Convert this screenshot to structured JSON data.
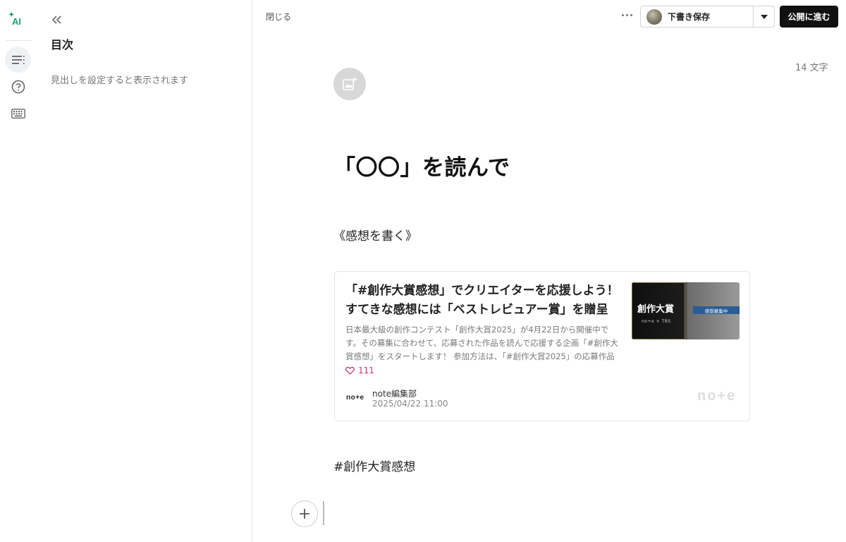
{
  "rail": {
    "ai_label": "AI",
    "items": [
      {
        "icon": "toc-list-icon",
        "active": true
      },
      {
        "icon": "help-icon",
        "active": false
      },
      {
        "icon": "keyboard-icon",
        "active": false
      }
    ]
  },
  "toc": {
    "title": "目次",
    "hint": "見出しを設定すると表示されます"
  },
  "topbar": {
    "close_label": "閉じる",
    "draft_label": "下書き保存",
    "publish_label": "公開に進む"
  },
  "editor": {
    "char_count": "14 文字",
    "title": "「〇〇」を読んで",
    "paragraph": "《感想を書く》",
    "hashtag": "#創作大賞感想"
  },
  "embed": {
    "title": "「#創作大賞感想」でクリエイターを応援しよう！すてきな感想には「ベストレビュアー賞」を贈呈",
    "description": "日本最大級の創作コンテスト「創作大賞2025」が4月22日から開催中です。その募集に合わせて、応募された作品を読んで応援する企画「#創作大賞感想」をスタートします！ 参加方法は、「#創作大賞2025」の応募作品を読…",
    "likes": "111",
    "author_logo": "no+e",
    "author": "note編集部",
    "date": "2025/04/22 11:00",
    "thumb_title": "創作大賞",
    "thumb_small": "no+e × TBS",
    "thumb_band": "感想募集中",
    "brand": "no+e"
  },
  "colors": {
    "accent_ai": "#1a9e72",
    "publish_bg": "#111111",
    "likes": "#d6336c"
  }
}
